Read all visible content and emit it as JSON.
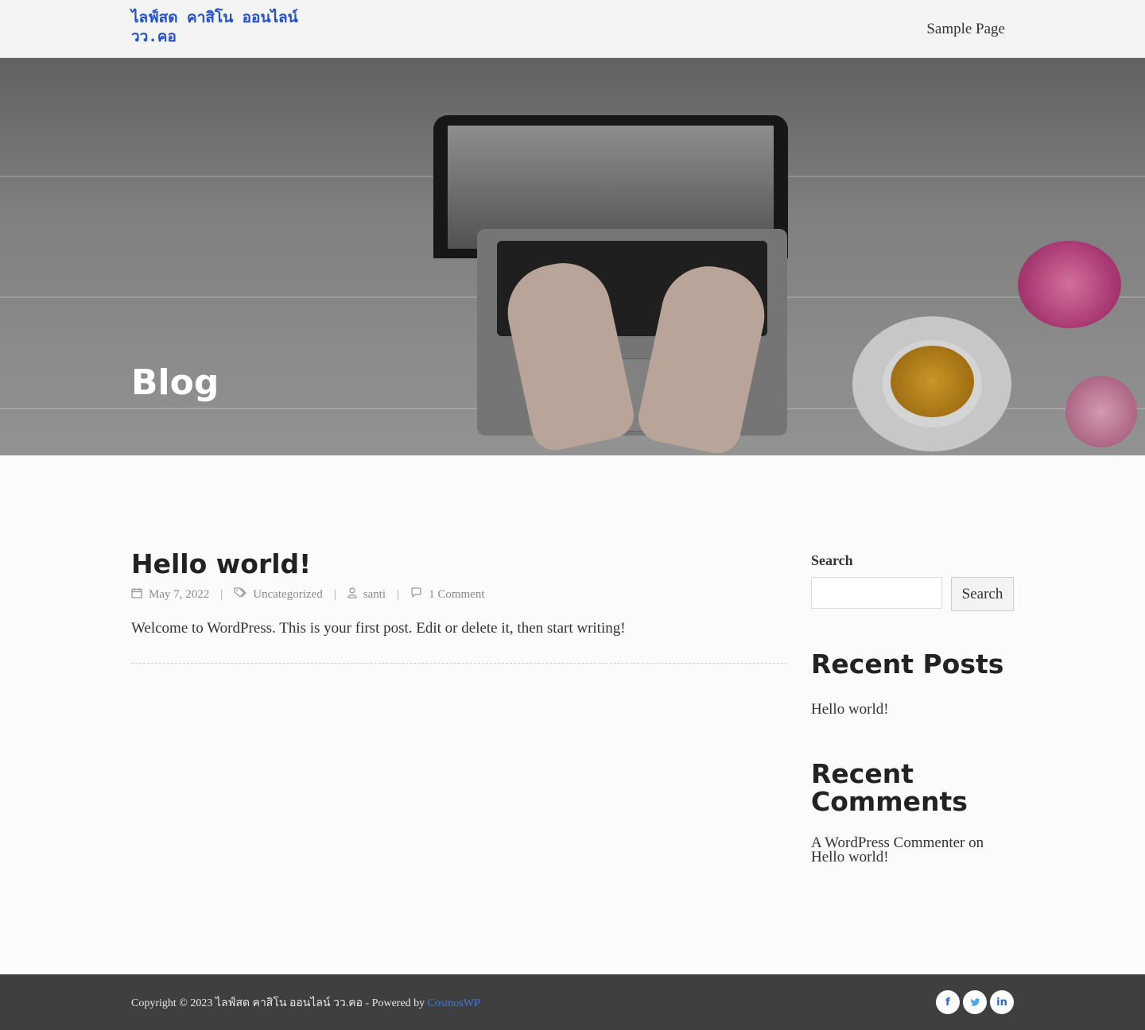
{
  "header": {
    "site_title": "ไลฟ์สด คาสิโน ออนไลน์ วว.คอ",
    "nav": [
      {
        "label": "Sample Page"
      }
    ]
  },
  "hero": {
    "title": "Blog"
  },
  "post": {
    "title": "Hello world!",
    "date": "May 7, 2022",
    "category": "Uncategorized",
    "author": "santi",
    "comments": "1 Comment",
    "excerpt": "Welcome to WordPress. This is your first post. Edit or delete it, then start writing!"
  },
  "sidebar": {
    "search_label": "Search",
    "search_placeholder": "",
    "search_button": "Search",
    "recent_posts_heading": "Recent Posts",
    "recent_posts": [
      {
        "title": "Hello world!"
      }
    ],
    "recent_comments_heading": "Recent Comments",
    "recent_comments": [
      {
        "author": "A WordPress Commenter",
        "on": "on",
        "post": "Hello world!"
      }
    ]
  },
  "footer": {
    "copyright": "Copyright © 2023 ไลฟ์สด คาสิโน ออนไลน์ วว.คอ - Powered by",
    "powered_link": "CosmosWP",
    "social": [
      {
        "icon": "facebook-icon",
        "glyph": "f"
      },
      {
        "icon": "twitter-icon",
        "glyph": "t"
      },
      {
        "icon": "linkedin-icon",
        "glyph": "in"
      }
    ]
  },
  "colors": {
    "brand": "#2452c9",
    "footer_bg": "#3f3f3f",
    "link": "#3d7ad8"
  }
}
